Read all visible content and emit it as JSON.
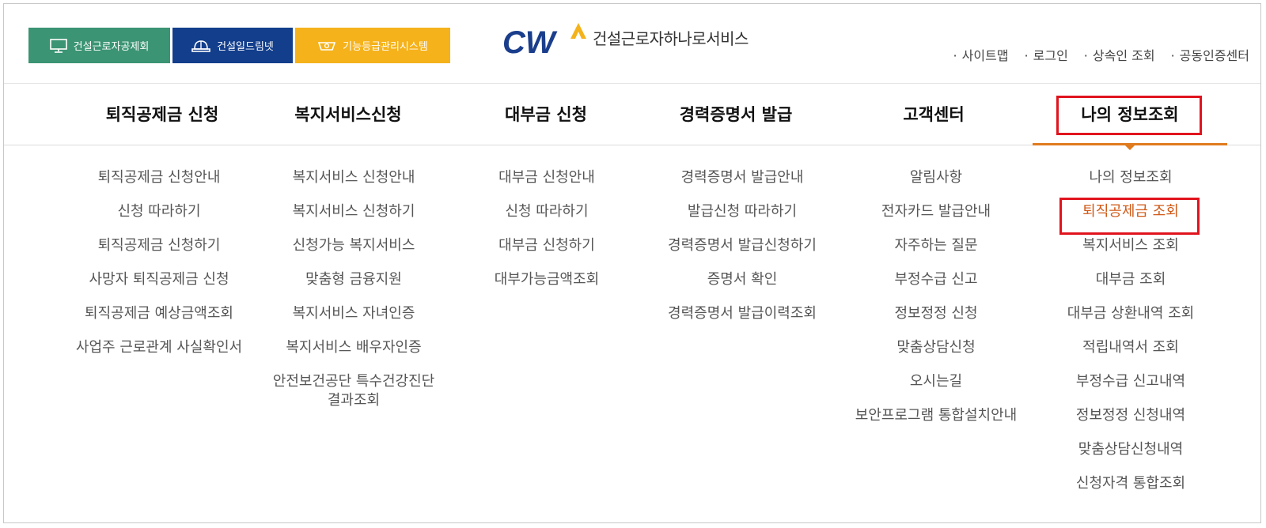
{
  "family_sites": [
    {
      "label": "건설근로자공제회",
      "icon": "monitor-icon",
      "color": "#3b9474"
    },
    {
      "label": "건설일드림넷",
      "icon": "hardhat-icon",
      "color": "#123e8c"
    },
    {
      "label": "기능등급관리시스템",
      "icon": "badge-icon",
      "color": "#f5b21b"
    }
  ],
  "logo": {
    "mark": "CW",
    "name": "건설근로자하나로서비스",
    "colors": {
      "blue": "#1a3e8c",
      "yellow": "#f4b21b"
    }
  },
  "utility_links": [
    "사이트맵",
    "로그인",
    "상속인 조회",
    "공동인증센터"
  ],
  "gnb": [
    {
      "label": "퇴직공제금 신청",
      "items": [
        "퇴직공제금 신청안내",
        "신청 따라하기",
        "퇴직공제금 신청하기",
        "사망자 퇴직공제금 신청",
        "퇴직공제금 예상금액조회",
        "사업주 근로관계 사실확인서"
      ]
    },
    {
      "label": "복지서비스신청",
      "items": [
        "복지서비스 신청안내",
        "복지서비스 신청하기",
        "신청가능 복지서비스",
        "맞춤형 금융지원",
        "복지서비스 자녀인증",
        "복지서비스 배우자인증",
        "안전보건공단 특수건강진단\n결과조회"
      ]
    },
    {
      "label": "대부금 신청",
      "items": [
        "대부금 신청안내",
        "신청 따라하기",
        "대부금 신청하기",
        "대부가능금액조회"
      ]
    },
    {
      "label": "경력증명서 발급",
      "items": [
        "경력증명서 발급안내",
        "발급신청 따라하기",
        "경력증명서 발급신청하기",
        "증명서 확인",
        "경력증명서 발급이력조회"
      ]
    },
    {
      "label": "고객센터",
      "items": [
        "알림사항",
        "전자카드 발급안내",
        "자주하는 질문",
        "부정수급 신고",
        "정보정정 신청",
        "맞춤상담신청",
        "오시는길",
        "보안프로그램 통합설치안내"
      ]
    },
    {
      "label": "나의 정보조회",
      "active": true,
      "items": [
        "나의 정보조회",
        "퇴직공제금 조회",
        "복지서비스 조회",
        "대부금 조회",
        "대부금 상환내역 조회",
        "적립내역서 조회",
        "부정수급 신고내역",
        "정보정정 신청내역",
        "맞춤상담신청내역",
        "신청자격 통합조회"
      ],
      "selected_item": "퇴직공제금 조회"
    }
  ],
  "colors": {
    "accent": "#e07b1f",
    "highlight_box": "#e0141e",
    "selected_text": "#d05a18"
  }
}
